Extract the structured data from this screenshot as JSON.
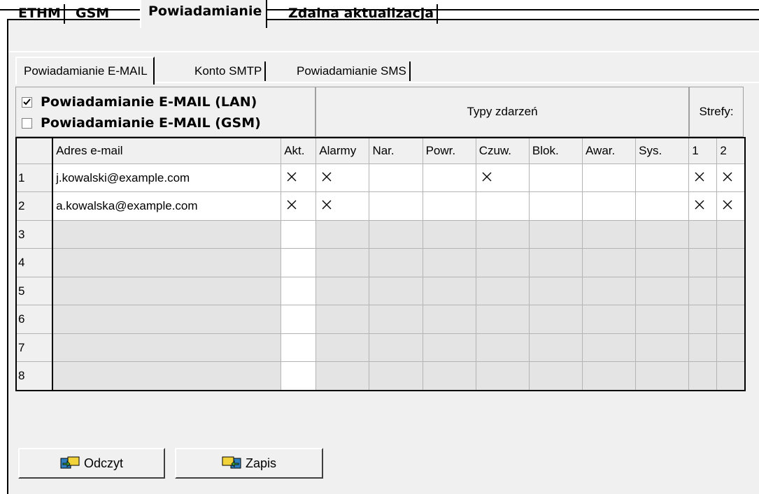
{
  "main_tabs": [
    "ETHM",
    "GSM",
    "Powiadamianie",
    "Zdalna aktualizacja"
  ],
  "sub_tabs": [
    "Powiadamianie E-MAIL",
    "Konto SMTP",
    "Powiadamianie SMS"
  ],
  "options": {
    "lan": {
      "label": "Powiadamianie E-MAIL (LAN)",
      "checked": true
    },
    "gsm": {
      "label": "Powiadamianie E-MAIL (GSM)",
      "checked": false
    }
  },
  "group_headers": {
    "events": "Typy zdarzeń",
    "zones": "Strefy:"
  },
  "columns": [
    "Adres e-mail",
    "Akt.",
    "Alarmy",
    "Nar.",
    "Powr.",
    "Czuw.",
    "Blok.",
    "Awar.",
    "Sys.",
    "1",
    "2"
  ],
  "rows": [
    {
      "num": "1",
      "email": "j.kowalski@example.com",
      "marks": [
        "X",
        "X",
        "",
        "",
        "X",
        "",
        "",
        "",
        "X",
        "X"
      ]
    },
    {
      "num": "2",
      "email": "a.kowalska@example.com",
      "marks": [
        "X",
        "X",
        "",
        "",
        "",
        "",
        "",
        "",
        "X",
        "X"
      ]
    },
    {
      "num": "3",
      "email": "",
      "marks": [
        "",
        "",
        "",
        "",
        "",
        "",
        "",
        "",
        "",
        ""
      ]
    },
    {
      "num": "4",
      "email": "",
      "marks": [
        "",
        "",
        "",
        "",
        "",
        "",
        "",
        "",
        "",
        ""
      ]
    },
    {
      "num": "5",
      "email": "",
      "marks": [
        "",
        "",
        "",
        "",
        "",
        "",
        "",
        "",
        "",
        ""
      ]
    },
    {
      "num": "6",
      "email": "",
      "marks": [
        "",
        "",
        "",
        "",
        "",
        "",
        "",
        "",
        "",
        ""
      ]
    },
    {
      "num": "7",
      "email": "",
      "marks": [
        "",
        "",
        "",
        "",
        "",
        "",
        "",
        "",
        "",
        ""
      ]
    },
    {
      "num": "8",
      "email": "",
      "marks": [
        "",
        "",
        "",
        "",
        "",
        "",
        "",
        "",
        "",
        ""
      ]
    }
  ],
  "buttons": {
    "read": "Odczyt",
    "write": "Zapis"
  },
  "icons": {
    "read": "device-read-icon",
    "write": "device-write-icon"
  }
}
